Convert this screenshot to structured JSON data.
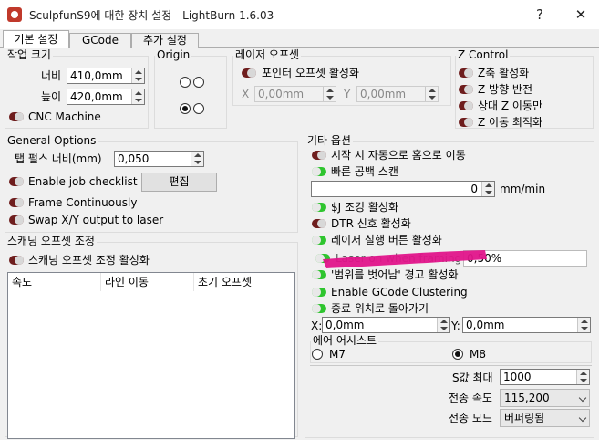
{
  "window": {
    "title": "SculpfunS9에 대한 장치 설정 - LightBurn 1.6.03",
    "help_label": "?",
    "close_label": "✕"
  },
  "tabs": [
    {
      "label": "기본 설정"
    },
    {
      "label": "GCode"
    },
    {
      "label": "추가 설정"
    }
  ],
  "work_size": {
    "title": "작업 크기",
    "width_label": "너비",
    "width_value": "410,0mm",
    "height_label": "높이",
    "height_value": "420,0mm",
    "cnc_label": "CNC Machine",
    "cnc_on": false
  },
  "origin": {
    "title": "Origin",
    "selected": "bottom-left"
  },
  "laser_offset": {
    "title": "레이저 오프셋",
    "enable_label": "포인터 오프셋 활성화",
    "enable_on": false,
    "x_label": "X",
    "x_value": "0,00mm",
    "y_label": "Y",
    "y_value": "0,00mm"
  },
  "z_control": {
    "title": "Z Control",
    "items": [
      {
        "label": "Z축 활성화",
        "on": false
      },
      {
        "label": "Z 방향 반전",
        "on": false
      },
      {
        "label": "상대 Z 이동만",
        "on": false
      },
      {
        "label": "Z 이동 최적화",
        "on": false
      }
    ]
  },
  "general": {
    "title": "General Options",
    "tab_pulse_label": "탭 펄스 너비(mm)",
    "tab_pulse_value": "0,050",
    "checklist_label": "Enable job checklist",
    "checklist_on": false,
    "edit_label": "편집",
    "frame_label": "Frame Continuously",
    "frame_on": false,
    "swap_label": "Swap X/Y output to laser",
    "swap_on": false
  },
  "scan_offset": {
    "title": "스캐닝 오프셋 조정",
    "enable_label": "스캐닝 오프셋 조정 활성화",
    "enable_on": false,
    "columns": [
      "속도",
      "라인 이동",
      "초기 오프셋"
    ]
  },
  "other": {
    "title": "기타 옵션",
    "auto_home_label": "시작 시 자동으로 홈으로 이동",
    "auto_home_on": false,
    "fast_scan_label": "빠른 공백 스캔",
    "fast_scan_on": true,
    "speed_value": "0",
    "speed_unit": "mm/min",
    "jog_label": "$J 조깅 활성화",
    "jog_on": true,
    "dtr_label": "DTR 신호 활성화",
    "dtr_on": false,
    "fire_label": "레이저 실행 버튼 활성화",
    "fire_on": true,
    "framing_label": "Laser on when framing",
    "framing_on": true,
    "framing_value": "0,50%",
    "out_of_bounds_label": "'범위를 벗어남' 경고 활성화",
    "out_of_bounds_on": true,
    "clustering_label": "Enable GCode Clustering",
    "clustering_on": true,
    "return_label": "종료 위치로 돌아가기",
    "return_on": true,
    "ret_x_label": "X:",
    "ret_x_value": "0,0mm",
    "ret_y_label": "Y:",
    "ret_y_value": "0,0mm"
  },
  "air_assist": {
    "title": "에어 어시스트",
    "m7_label": "M7",
    "m8_label": "M8",
    "selected": "M8"
  },
  "s_max": {
    "label": "S값 최대",
    "value": "1000"
  },
  "baud": {
    "label": "전송 속도",
    "value": "115,200"
  },
  "transfer_mode": {
    "label": "전송 모드",
    "value": "버퍼링됨"
  },
  "colors": {
    "toggle_off": "#6e1d1d",
    "toggle_on": "#2fc52f",
    "highlight": "#e0148a"
  }
}
